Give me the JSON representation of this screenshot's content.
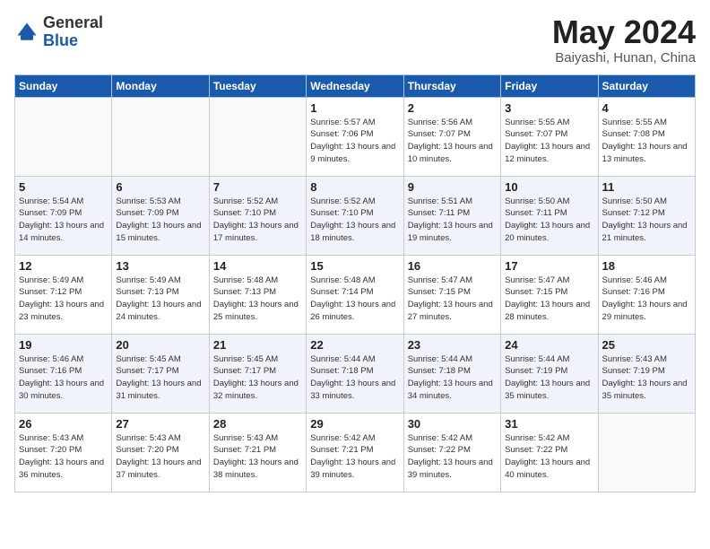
{
  "header": {
    "logo_general": "General",
    "logo_blue": "Blue",
    "title": "May 2024",
    "subtitle": "Baiyashi, Hunan, China"
  },
  "weekdays": [
    "Sunday",
    "Monday",
    "Tuesday",
    "Wednesday",
    "Thursday",
    "Friday",
    "Saturday"
  ],
  "weeks": [
    [
      {
        "day": "",
        "sunrise": "",
        "sunset": "",
        "daylight": ""
      },
      {
        "day": "",
        "sunrise": "",
        "sunset": "",
        "daylight": ""
      },
      {
        "day": "",
        "sunrise": "",
        "sunset": "",
        "daylight": ""
      },
      {
        "day": "1",
        "sunrise": "Sunrise: 5:57 AM",
        "sunset": "Sunset: 7:06 PM",
        "daylight": "Daylight: 13 hours and 9 minutes."
      },
      {
        "day": "2",
        "sunrise": "Sunrise: 5:56 AM",
        "sunset": "Sunset: 7:07 PM",
        "daylight": "Daylight: 13 hours and 10 minutes."
      },
      {
        "day": "3",
        "sunrise": "Sunrise: 5:55 AM",
        "sunset": "Sunset: 7:07 PM",
        "daylight": "Daylight: 13 hours and 12 minutes."
      },
      {
        "day": "4",
        "sunrise": "Sunrise: 5:55 AM",
        "sunset": "Sunset: 7:08 PM",
        "daylight": "Daylight: 13 hours and 13 minutes."
      }
    ],
    [
      {
        "day": "5",
        "sunrise": "Sunrise: 5:54 AM",
        "sunset": "Sunset: 7:09 PM",
        "daylight": "Daylight: 13 hours and 14 minutes."
      },
      {
        "day": "6",
        "sunrise": "Sunrise: 5:53 AM",
        "sunset": "Sunset: 7:09 PM",
        "daylight": "Daylight: 13 hours and 15 minutes."
      },
      {
        "day": "7",
        "sunrise": "Sunrise: 5:52 AM",
        "sunset": "Sunset: 7:10 PM",
        "daylight": "Daylight: 13 hours and 17 minutes."
      },
      {
        "day": "8",
        "sunrise": "Sunrise: 5:52 AM",
        "sunset": "Sunset: 7:10 PM",
        "daylight": "Daylight: 13 hours and 18 minutes."
      },
      {
        "day": "9",
        "sunrise": "Sunrise: 5:51 AM",
        "sunset": "Sunset: 7:11 PM",
        "daylight": "Daylight: 13 hours and 19 minutes."
      },
      {
        "day": "10",
        "sunrise": "Sunrise: 5:50 AM",
        "sunset": "Sunset: 7:11 PM",
        "daylight": "Daylight: 13 hours and 20 minutes."
      },
      {
        "day": "11",
        "sunrise": "Sunrise: 5:50 AM",
        "sunset": "Sunset: 7:12 PM",
        "daylight": "Daylight: 13 hours and 21 minutes."
      }
    ],
    [
      {
        "day": "12",
        "sunrise": "Sunrise: 5:49 AM",
        "sunset": "Sunset: 7:12 PM",
        "daylight": "Daylight: 13 hours and 23 minutes."
      },
      {
        "day": "13",
        "sunrise": "Sunrise: 5:49 AM",
        "sunset": "Sunset: 7:13 PM",
        "daylight": "Daylight: 13 hours and 24 minutes."
      },
      {
        "day": "14",
        "sunrise": "Sunrise: 5:48 AM",
        "sunset": "Sunset: 7:13 PM",
        "daylight": "Daylight: 13 hours and 25 minutes."
      },
      {
        "day": "15",
        "sunrise": "Sunrise: 5:48 AM",
        "sunset": "Sunset: 7:14 PM",
        "daylight": "Daylight: 13 hours and 26 minutes."
      },
      {
        "day": "16",
        "sunrise": "Sunrise: 5:47 AM",
        "sunset": "Sunset: 7:15 PM",
        "daylight": "Daylight: 13 hours and 27 minutes."
      },
      {
        "day": "17",
        "sunrise": "Sunrise: 5:47 AM",
        "sunset": "Sunset: 7:15 PM",
        "daylight": "Daylight: 13 hours and 28 minutes."
      },
      {
        "day": "18",
        "sunrise": "Sunrise: 5:46 AM",
        "sunset": "Sunset: 7:16 PM",
        "daylight": "Daylight: 13 hours and 29 minutes."
      }
    ],
    [
      {
        "day": "19",
        "sunrise": "Sunrise: 5:46 AM",
        "sunset": "Sunset: 7:16 PM",
        "daylight": "Daylight: 13 hours and 30 minutes."
      },
      {
        "day": "20",
        "sunrise": "Sunrise: 5:45 AM",
        "sunset": "Sunset: 7:17 PM",
        "daylight": "Daylight: 13 hours and 31 minutes."
      },
      {
        "day": "21",
        "sunrise": "Sunrise: 5:45 AM",
        "sunset": "Sunset: 7:17 PM",
        "daylight": "Daylight: 13 hours and 32 minutes."
      },
      {
        "day": "22",
        "sunrise": "Sunrise: 5:44 AM",
        "sunset": "Sunset: 7:18 PM",
        "daylight": "Daylight: 13 hours and 33 minutes."
      },
      {
        "day": "23",
        "sunrise": "Sunrise: 5:44 AM",
        "sunset": "Sunset: 7:18 PM",
        "daylight": "Daylight: 13 hours and 34 minutes."
      },
      {
        "day": "24",
        "sunrise": "Sunrise: 5:44 AM",
        "sunset": "Sunset: 7:19 PM",
        "daylight": "Daylight: 13 hours and 35 minutes."
      },
      {
        "day": "25",
        "sunrise": "Sunrise: 5:43 AM",
        "sunset": "Sunset: 7:19 PM",
        "daylight": "Daylight: 13 hours and 35 minutes."
      }
    ],
    [
      {
        "day": "26",
        "sunrise": "Sunrise: 5:43 AM",
        "sunset": "Sunset: 7:20 PM",
        "daylight": "Daylight: 13 hours and 36 minutes."
      },
      {
        "day": "27",
        "sunrise": "Sunrise: 5:43 AM",
        "sunset": "Sunset: 7:20 PM",
        "daylight": "Daylight: 13 hours and 37 minutes."
      },
      {
        "day": "28",
        "sunrise": "Sunrise: 5:43 AM",
        "sunset": "Sunset: 7:21 PM",
        "daylight": "Daylight: 13 hours and 38 minutes."
      },
      {
        "day": "29",
        "sunrise": "Sunrise: 5:42 AM",
        "sunset": "Sunset: 7:21 PM",
        "daylight": "Daylight: 13 hours and 39 minutes."
      },
      {
        "day": "30",
        "sunrise": "Sunrise: 5:42 AM",
        "sunset": "Sunset: 7:22 PM",
        "daylight": "Daylight: 13 hours and 39 minutes."
      },
      {
        "day": "31",
        "sunrise": "Sunrise: 5:42 AM",
        "sunset": "Sunset: 7:22 PM",
        "daylight": "Daylight: 13 hours and 40 minutes."
      },
      {
        "day": "",
        "sunrise": "",
        "sunset": "",
        "daylight": ""
      }
    ]
  ]
}
